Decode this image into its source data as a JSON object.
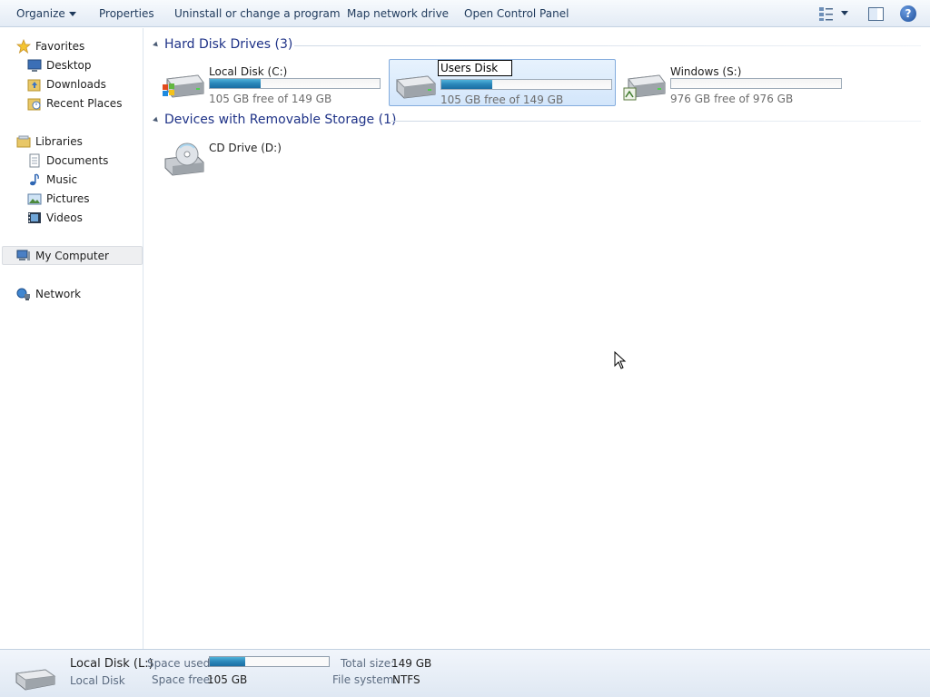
{
  "toolbar": {
    "organize": "Organize",
    "properties": "Properties",
    "uninstall": "Uninstall or change a program",
    "map_drive": "Map network drive",
    "control_panel": "Open Control Panel",
    "icons": [
      "view-options-icon",
      "preview-pane-icon",
      "help-icon"
    ],
    "help_glyph": "?"
  },
  "sidebar": {
    "favorites": {
      "label": "Favorites",
      "items": [
        {
          "label": "Desktop",
          "icon": "desktop-icon"
        },
        {
          "label": "Downloads",
          "icon": "downloads-icon"
        },
        {
          "label": "Recent Places",
          "icon": "recent-places-icon"
        }
      ]
    },
    "libraries": {
      "label": "Libraries",
      "items": [
        {
          "label": "Documents",
          "icon": "documents-icon"
        },
        {
          "label": "Music",
          "icon": "music-icon"
        },
        {
          "label": "Pictures",
          "icon": "pictures-icon"
        },
        {
          "label": "Videos",
          "icon": "videos-icon"
        }
      ]
    },
    "computer": {
      "label": "My Computer",
      "selected": true
    },
    "network": {
      "label": "Network"
    }
  },
  "content": {
    "groups": [
      {
        "title": "Hard Disk Drives (3)",
        "drives": [
          {
            "name": "Local Disk (C:)",
            "free_text": "105 GB free of 149 GB",
            "used_fraction": 0.3,
            "icon": "windows-drive-icon"
          },
          {
            "name": "Users Disk",
            "free_text": "105 GB free of 149 GB",
            "used_fraction": 0.3,
            "icon": "hard-drive-icon",
            "selected": true,
            "renaming": true
          },
          {
            "name": "Windows (S:)",
            "free_text": "976 GB free of 976 GB",
            "used_fraction": 0.0,
            "icon": "shared-drive-icon"
          }
        ]
      },
      {
        "title": "Devices with Removable Storage (1)",
        "drives": [
          {
            "name": "CD Drive (D:)",
            "icon": "cd-drive-icon"
          }
        ]
      }
    ]
  },
  "details": {
    "name": "Local Disk (L:)",
    "type": "Local Disk",
    "space_used_label": "Space used:",
    "space_used_fraction": 0.3,
    "space_free_label": "Space free:",
    "space_free_value": "105 GB",
    "total_size_label": "Total size:",
    "total_size_value": "149 GB",
    "file_system_label": "File system:",
    "file_system_value": "NTFS"
  },
  "colors": {
    "accent_title": "#1e3287",
    "bar_fill": "#2a86b9",
    "selection": "#d3e6fb"
  }
}
